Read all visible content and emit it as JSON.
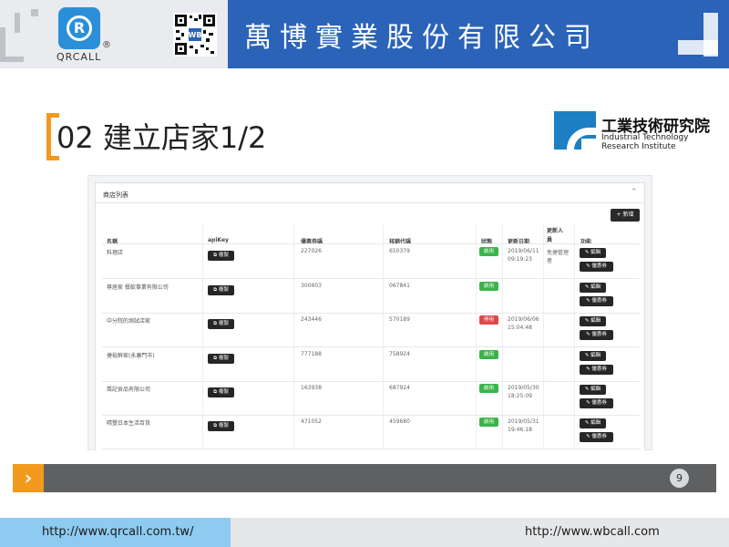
{
  "header": {
    "company_name": "萬博實業股份有限公司",
    "logo_text": "QRCALL",
    "logo_mark": "R",
    "logo_reg": "®",
    "qr_badge": "WB"
  },
  "slide": {
    "title": "02 建立店家1/2",
    "itri_name": "工業技術研究院",
    "itri_en_line1": "Industrial Technology",
    "itri_en_line2": "Research Institute"
  },
  "panel": {
    "title": "商店列表",
    "collapse_icon": "⌃",
    "add_button": "+ 新增",
    "columns": [
      "名稱",
      "apiKey",
      "優惠券碼",
      "核銷代碼",
      "狀態",
      "更新日期",
      "更新人員",
      "功能"
    ],
    "copy_label": "複製",
    "edit_label": "編輯",
    "coupon_label": "優惠券",
    "rows": [
      {
        "name": "料理店",
        "coupon_code": "227026",
        "verify_code": "650379",
        "status": "啟用",
        "status_color": "#3bb44a",
        "date": "2019/06/11",
        "time": "09:19:23",
        "updater_line1": "免捷管理",
        "updater_line2": "者"
      },
      {
        "name": "尊居家 餐飲事業有限公司",
        "coupon_code": "300603",
        "verify_code": "067841",
        "status": "啟用",
        "status_color": "#3bb44a",
        "date": "",
        "time": "",
        "updater_line1": "",
        "updater_line2": ""
      },
      {
        "name": "中分院的測試店家",
        "coupon_code": "243446",
        "verify_code": "570189",
        "status": "停用",
        "status_color": "#e04848",
        "date": "2019/06/06",
        "time": "15:04:48",
        "updater_line1": "",
        "updater_line2": ""
      },
      {
        "name": "捷裕鮮家(永康門市)",
        "coupon_code": "777188",
        "verify_code": "758924",
        "status": "啟用",
        "status_color": "#3bb44a",
        "date": "",
        "time": "",
        "updater_line1": "",
        "updater_line2": ""
      },
      {
        "name": "喬記食品有限公司",
        "coupon_code": "163938",
        "verify_code": "687924",
        "status": "啟用",
        "status_color": "#3bb44a",
        "date": "2019/05/30",
        "time": "18:25:09",
        "updater_line1": "",
        "updater_line2": ""
      },
      {
        "name": "晴豐日本生活百貨",
        "coupon_code": "471052",
        "verify_code": "459680",
        "status": "啟用",
        "status_color": "#3bb44a",
        "date": "2019/05/31",
        "time": "19:46:18",
        "updater_line1": "",
        "updater_line2": ""
      }
    ]
  },
  "footer": {
    "arrow": "›",
    "page_number": "9",
    "url_left": "http://www.qrcall.com.tw/",
    "url_right": "http://www.wbcall.com"
  },
  "colors": {
    "brand_blue": "#2a63b8",
    "accent_orange": "#f39a1e",
    "footer_blue": "#8ecbf0"
  }
}
